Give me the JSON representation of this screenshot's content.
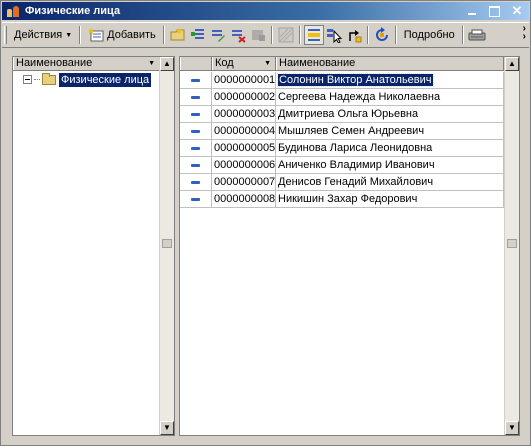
{
  "window": {
    "title": "Физические лица"
  },
  "toolbar": {
    "actions_label": "Действия",
    "add_label": "Добавить",
    "details_label": "Подробно"
  },
  "tree": {
    "header": "Наименование",
    "root_label": "Физические лица"
  },
  "table": {
    "columns": [
      "",
      "Код",
      "Наименование"
    ],
    "rows": [
      {
        "code": "0000000001",
        "name": "Солонин Виктор  Анатольевич"
      },
      {
        "code": "0000000002",
        "name": "Сергеева Надежда Николаевна"
      },
      {
        "code": "0000000003",
        "name": "Дмитриева Ольга Юрьевна"
      },
      {
        "code": "0000000004",
        "name": "Мышляев Семен Андреевич"
      },
      {
        "code": "0000000005",
        "name": "Будинова Лариса Леонидовна"
      },
      {
        "code": "0000000006",
        "name": "Аниченко Владимир Иванович"
      },
      {
        "code": "0000000007",
        "name": "Денисов Генадий Михайлович"
      },
      {
        "code": "0000000008",
        "name": "Никишин Захар Федорович"
      }
    ],
    "selected_row": 0
  },
  "colors": {
    "selection": "#0a246a",
    "title_gradient_start": "#0a246a",
    "title_gradient_end": "#a6caf0",
    "row_marker": "#3060c0"
  }
}
